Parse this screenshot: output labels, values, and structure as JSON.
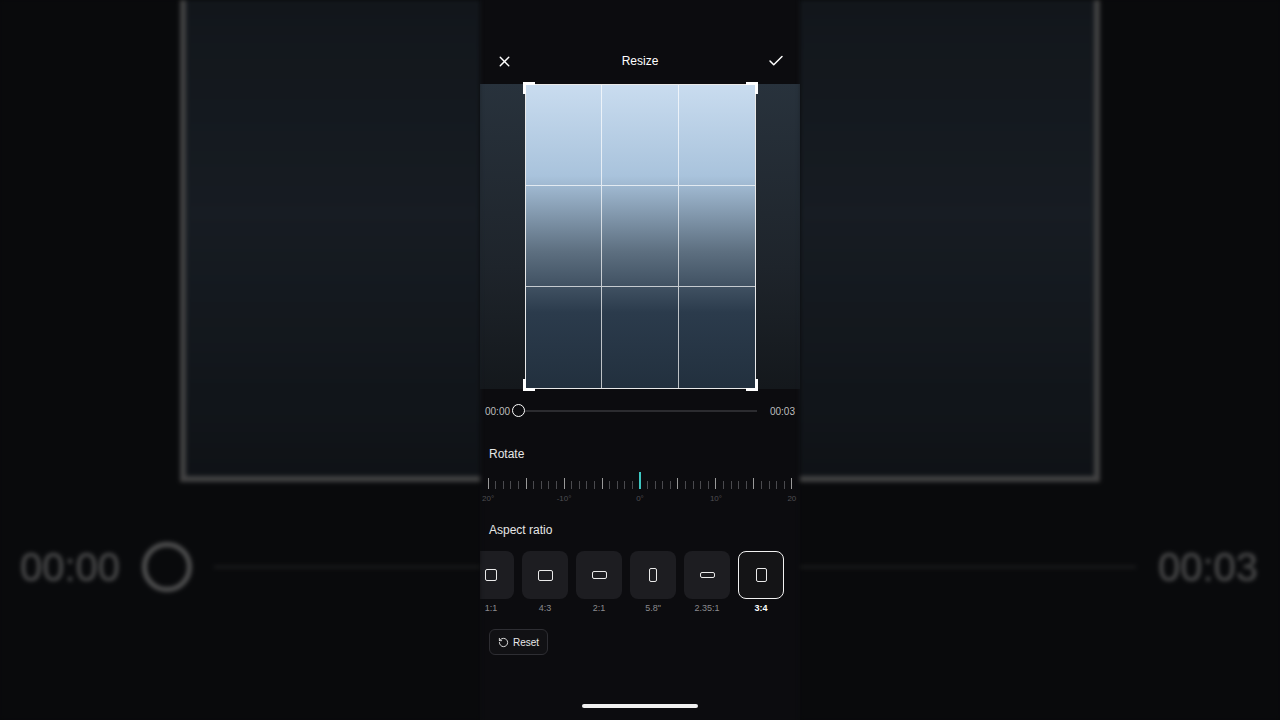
{
  "header": {
    "title": "Resize"
  },
  "timeline": {
    "start": "00:00",
    "end": "00:03",
    "level": 0
  },
  "rotate": {
    "label": "Rotate",
    "ticks": [
      {
        "label": "20°",
        "selected": false
      },
      {
        "label": "-10°",
        "selected": false
      },
      {
        "label": "0°",
        "selected": true
      },
      {
        "label": "10°",
        "selected": false
      },
      {
        "label": "20",
        "selected": false
      }
    ]
  },
  "aspect_ratio": {
    "label": "Aspect ratio",
    "options": [
      {
        "label": "1:1",
        "selected": false
      },
      {
        "label": "4:3",
        "selected": false
      },
      {
        "label": "2:1",
        "selected": false
      },
      {
        "label": "5.8\"",
        "selected": false
      },
      {
        "label": "2.35:1",
        "selected": false
      },
      {
        "label": "3:4",
        "selected": true
      }
    ]
  },
  "reset": {
    "label": "Reset"
  }
}
